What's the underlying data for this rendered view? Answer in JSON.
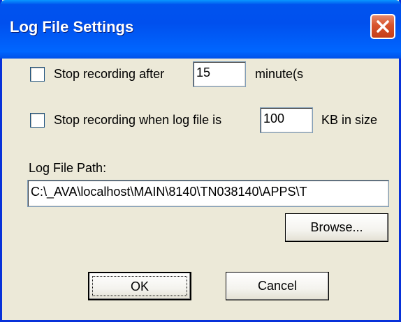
{
  "window": {
    "title": "Log File Settings"
  },
  "icons": {
    "close": "close-icon"
  },
  "options": {
    "stop_after": {
      "label": "Stop recording after",
      "value": "15",
      "unit": "minute(s",
      "checked": false
    },
    "stop_size": {
      "label": "Stop recording when log file is",
      "value": "100",
      "unit": "KB in size",
      "checked": false
    }
  },
  "log_path": {
    "label": "Log File Path:",
    "value": "C:\\_AVA\\localhost\\MAIN\\8140\\TN038140\\APPS\\T"
  },
  "buttons": {
    "browse": "Browse...",
    "ok": "OK",
    "cancel": "Cancel"
  },
  "colors": {
    "title_bar": "#0050ee",
    "close_button": "#d7532c",
    "dialog_background": "#ece9d8"
  }
}
